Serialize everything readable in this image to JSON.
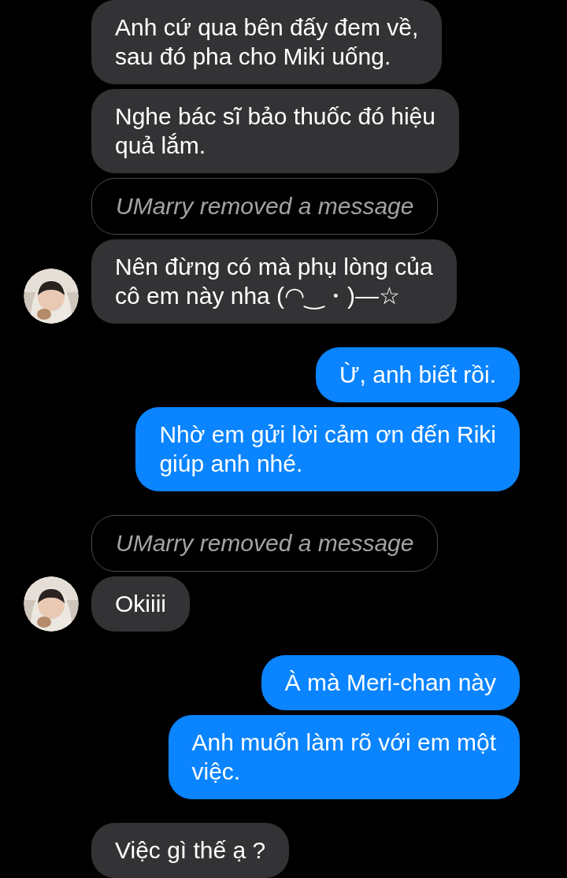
{
  "messages": [
    {
      "kind": "incoming",
      "text": "Anh cứ qua bên đấy đem về,\nsau đó pha cho Miki uống."
    },
    {
      "kind": "incoming",
      "text": "Nghe bác sĩ bảo thuốc đó hiệu\nquả lắm."
    },
    {
      "kind": "removed",
      "text": "UMarry removed a message"
    },
    {
      "kind": "incoming",
      "text": "Nên đừng có mà phụ lòng của\ncô em này nha (◠‿・)—☆"
    },
    {
      "kind": "outgoing",
      "text": "Ừ, anh biết rồi."
    },
    {
      "kind": "outgoing",
      "text": "Nhờ em gửi lời cảm ơn đến Riki\ngiúp anh nhé."
    },
    {
      "kind": "removed",
      "text": "UMarry removed a message"
    },
    {
      "kind": "incoming",
      "text": "Okiiii"
    },
    {
      "kind": "outgoing",
      "text": "À mà Meri-chan này"
    },
    {
      "kind": "outgoing",
      "text": "Anh muốn làm rõ với em một\nviệc."
    },
    {
      "kind": "incoming",
      "text": "Việc gì thế ạ ?"
    }
  ]
}
